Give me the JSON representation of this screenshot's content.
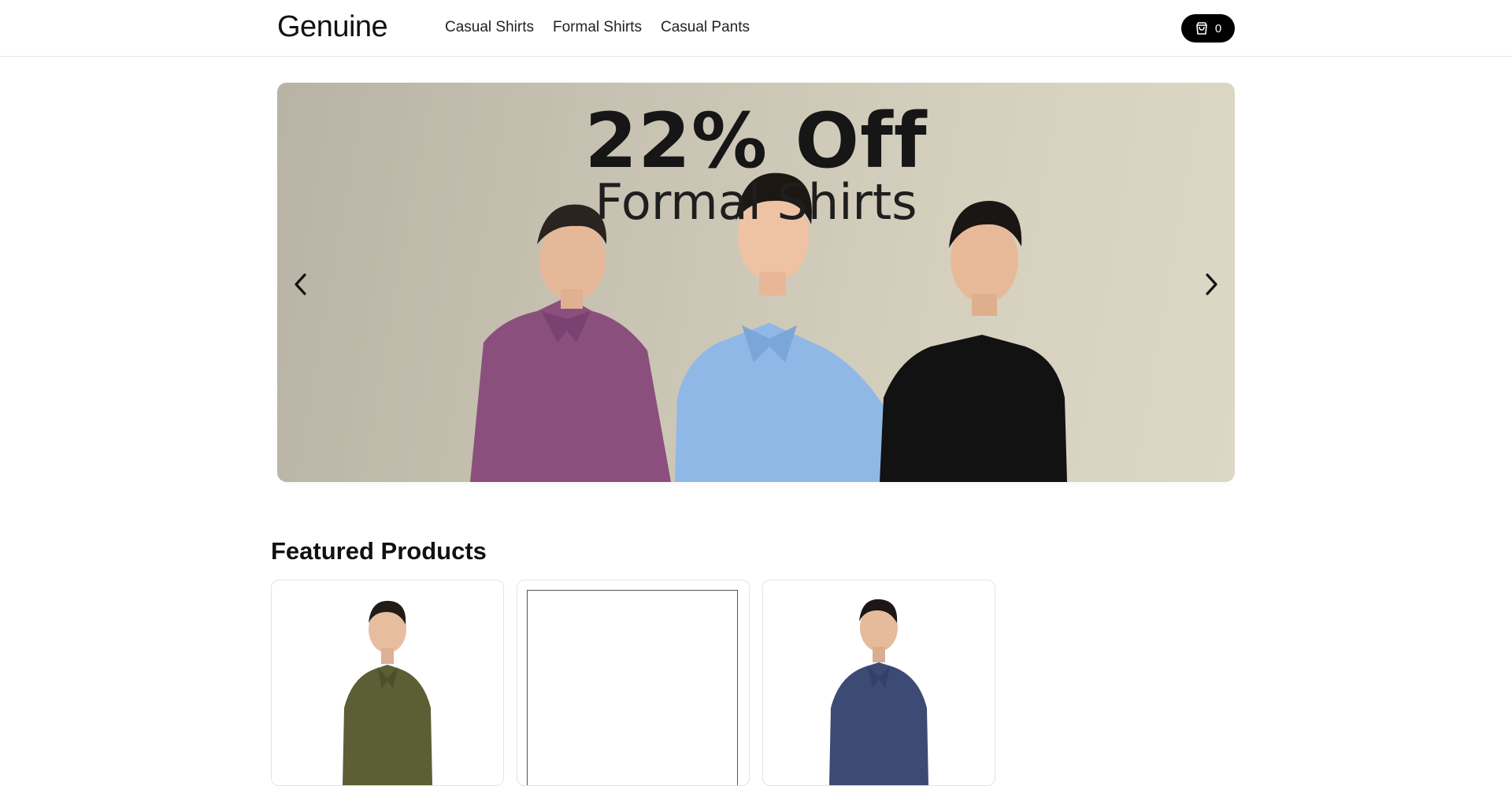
{
  "header": {
    "brand": "Genuine",
    "nav": [
      {
        "label": "Casual Shirts"
      },
      {
        "label": "Formal Shirts"
      },
      {
        "label": "Casual Pants"
      }
    ],
    "cart": {
      "icon": "shopping-bag-icon",
      "count": "0"
    }
  },
  "hero": {
    "headline": "22% Off",
    "subheadline": "Formal Shirts",
    "prev_icon": "chevron-left-icon",
    "next_icon": "chevron-right-icon",
    "shirt_colors": [
      "#8b4f7d",
      "#8fb8e6",
      "#121212"
    ],
    "background": "#cfc9b8"
  },
  "featured": {
    "title": "Featured Products",
    "products": [
      {
        "shirt_color": "#5c5e34"
      },
      {
        "image_missing": true
      },
      {
        "shirt_color": "#3d4a74"
      }
    ]
  },
  "colors": {
    "accent": "#000000",
    "text": "#111111"
  }
}
